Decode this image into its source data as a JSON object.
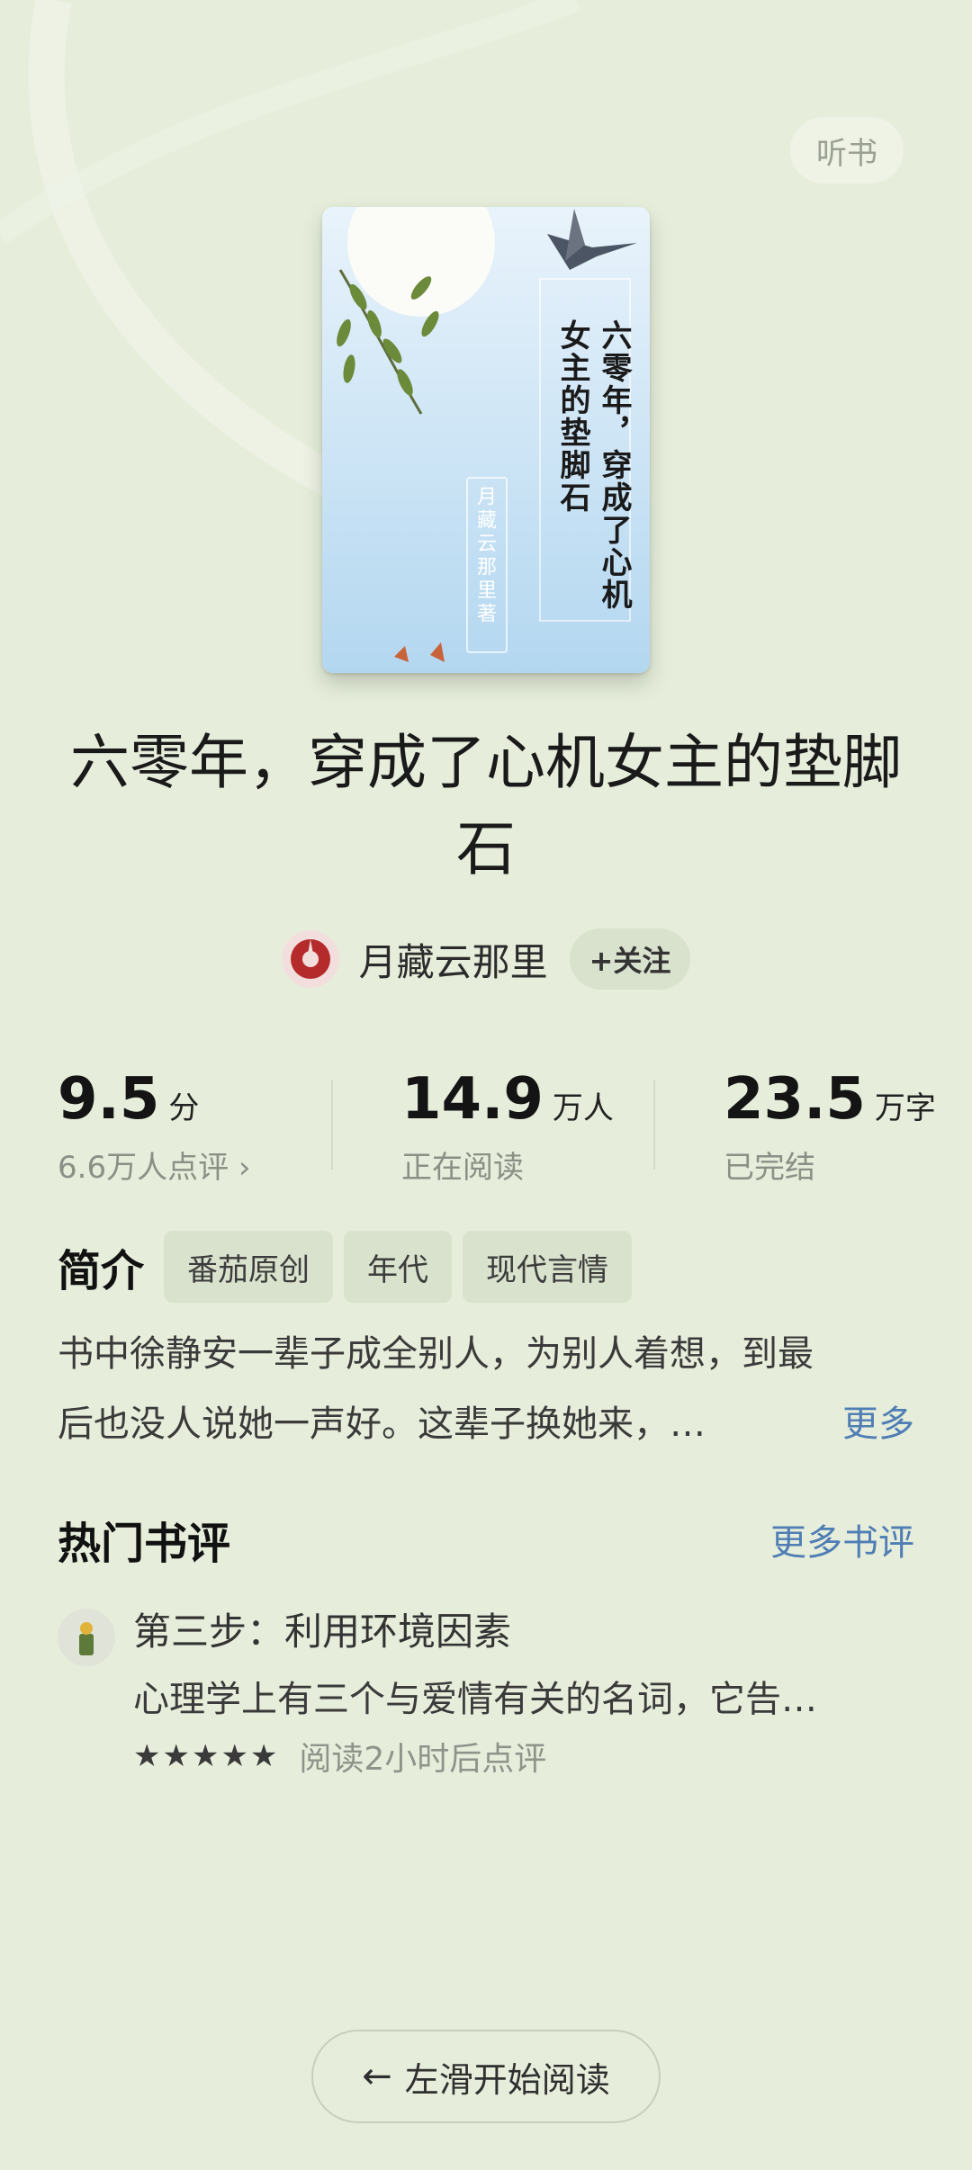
{
  "header": {
    "listen_label": "听书"
  },
  "book": {
    "cover_title_line1": "六零年，穿成了心机",
    "cover_title_line2": "女主的垫脚石",
    "cover_author": "月藏云那里著",
    "title": "六零年，穿成了心机女主的垫脚石"
  },
  "author": {
    "name": "月藏云那里",
    "follow_label": "+关注"
  },
  "stats": [
    {
      "value": "9.5",
      "unit": "分",
      "label": "6.6万人点评 ›"
    },
    {
      "value": "14.9",
      "unit": "万人",
      "label": "正在阅读"
    },
    {
      "value": "23.5",
      "unit": "万字",
      "label": "已完结"
    }
  ],
  "intro": {
    "title": "简介",
    "tags": [
      "番茄原创",
      "年代",
      "现代言情"
    ],
    "line1": "书中徐静安一辈子成全别人，为别人着想，到最",
    "line2": "后也没人说她一声好。这辈子换她来，…",
    "more_label": "更多"
  },
  "reviews_section": {
    "title": "热门书评",
    "more_label": "更多书评",
    "items": [
      {
        "title": "第三步：利用环境因素",
        "body": "心理学上有三个与爱情有关的名词，它告…",
        "rating": 5,
        "stars": "★★★★★",
        "note": "阅读2小时后点评"
      }
    ]
  },
  "footer": {
    "start_label": "左滑开始阅读",
    "arrow": "←"
  },
  "colors": {
    "background": "#e6eedb",
    "link": "#4f7db4",
    "tag_bg": "#d9e2cd"
  }
}
